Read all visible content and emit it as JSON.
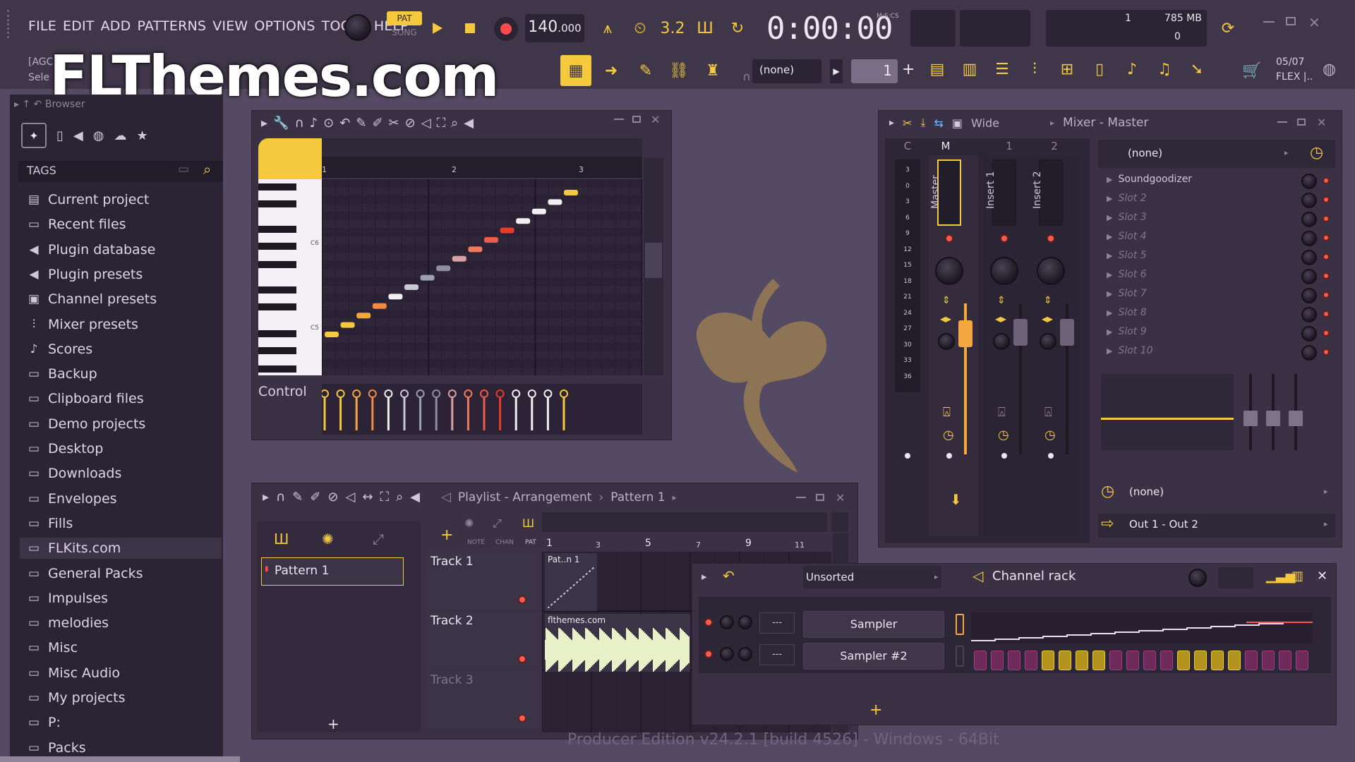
{
  "menu": [
    "FILE",
    "EDIT",
    "ADD",
    "PATTERNS",
    "VIEW",
    "OPTIONS",
    "TOOLS",
    "HELP"
  ],
  "transport": {
    "pat_label": "PAT",
    "song_label": "SONG",
    "tempo_int": "140",
    "tempo_dec": ".000",
    "time": "0:00:00",
    "time_label": "M:S:CS",
    "cpu_value": "1",
    "memory": "785 MB",
    "voices": "0"
  },
  "hint": {
    "line1": "[AGC",
    "line2": "Sele"
  },
  "watermark": "FLThemes.com",
  "toolbar2": {
    "pattern_selector": "(none)",
    "pattern_number": "1",
    "date": "05/07",
    "flex": "FLEX |.."
  },
  "browser": {
    "title": "Browser",
    "tags_label": "TAGS",
    "items": [
      {
        "label": "Current project",
        "icon": "project-icon"
      },
      {
        "label": "Recent files",
        "icon": "folder-icon"
      },
      {
        "label": "Plugin database",
        "icon": "plugin-icon"
      },
      {
        "label": "Plugin presets",
        "icon": "plugin-icon"
      },
      {
        "label": "Channel presets",
        "icon": "channel-icon"
      },
      {
        "label": "Mixer presets",
        "icon": "mixer-icon"
      },
      {
        "label": "Scores",
        "icon": "note-icon"
      },
      {
        "label": "Backup",
        "icon": "folder-icon"
      },
      {
        "label": "Clipboard files",
        "icon": "folder-icon"
      },
      {
        "label": "Demo projects",
        "icon": "folder-icon"
      },
      {
        "label": "Desktop",
        "icon": "folder-icon"
      },
      {
        "label": "Downloads",
        "icon": "folder-icon"
      },
      {
        "label": "Envelopes",
        "icon": "folder-icon"
      },
      {
        "label": "Fills",
        "icon": "folder-icon"
      },
      {
        "label": "FLKits.com",
        "icon": "folder-icon"
      },
      {
        "label": "General Packs",
        "icon": "folder-icon"
      },
      {
        "label": "Impulses",
        "icon": "folder-icon"
      },
      {
        "label": "melodies",
        "icon": "folder-icon"
      },
      {
        "label": "Misc",
        "icon": "folder-icon"
      },
      {
        "label": "Misc Audio",
        "icon": "folder-icon"
      },
      {
        "label": "My projects",
        "icon": "folder-icon"
      },
      {
        "label": "P:",
        "icon": "folder-icon"
      },
      {
        "label": "Packs",
        "icon": "folder-icon"
      }
    ]
  },
  "piano_roll": {
    "bar_labels": [
      "1",
      "2",
      "3"
    ],
    "key_labels": [
      "C6",
      "C5"
    ],
    "control_label": "Control"
  },
  "mixer": {
    "title": "Mixer - Master",
    "view": "Wide",
    "strip_headers": [
      "C",
      "M",
      "1",
      "2"
    ],
    "strip_names": [
      "Master",
      "Insert 1",
      "Insert 2"
    ],
    "meter_scale": [
      "3",
      "0",
      "3",
      "6",
      "9",
      "12",
      "15",
      "18",
      "21",
      "24",
      "27",
      "30",
      "33",
      "36"
    ],
    "preset": "(none)",
    "slots": [
      "Soundgoodizer",
      "Slot 2",
      "Slot 3",
      "Slot 4",
      "Slot 5",
      "Slot 6",
      "Slot 7",
      "Slot 8",
      "Slot 9",
      "Slot 10"
    ],
    "eq_selector": "(none)",
    "output": "Out 1 - Out 2"
  },
  "playlist": {
    "title": "Playlist - Arrangement",
    "pattern_selector": "Pattern 1",
    "patterns": [
      "Pattern 1"
    ],
    "tabs": [
      "NOTE",
      "CHAN",
      "PAT"
    ],
    "bar_labels": [
      "1",
      "3",
      "5",
      "7",
      "9",
      "11"
    ],
    "tracks": [
      "Track 1",
      "Track 2",
      "Track 3"
    ],
    "clip1": "Pat..n 1",
    "clip2": "flthemes.com"
  },
  "channel_rack": {
    "title": "Channel rack",
    "filter": "Unsorted",
    "channels": [
      {
        "name": "Sampler",
        "route": "---"
      },
      {
        "name": "Sampler #2",
        "route": "---"
      }
    ]
  },
  "status_text": "Producer Edition v24.2.1 [build 4526] - Windows - 64Bit"
}
